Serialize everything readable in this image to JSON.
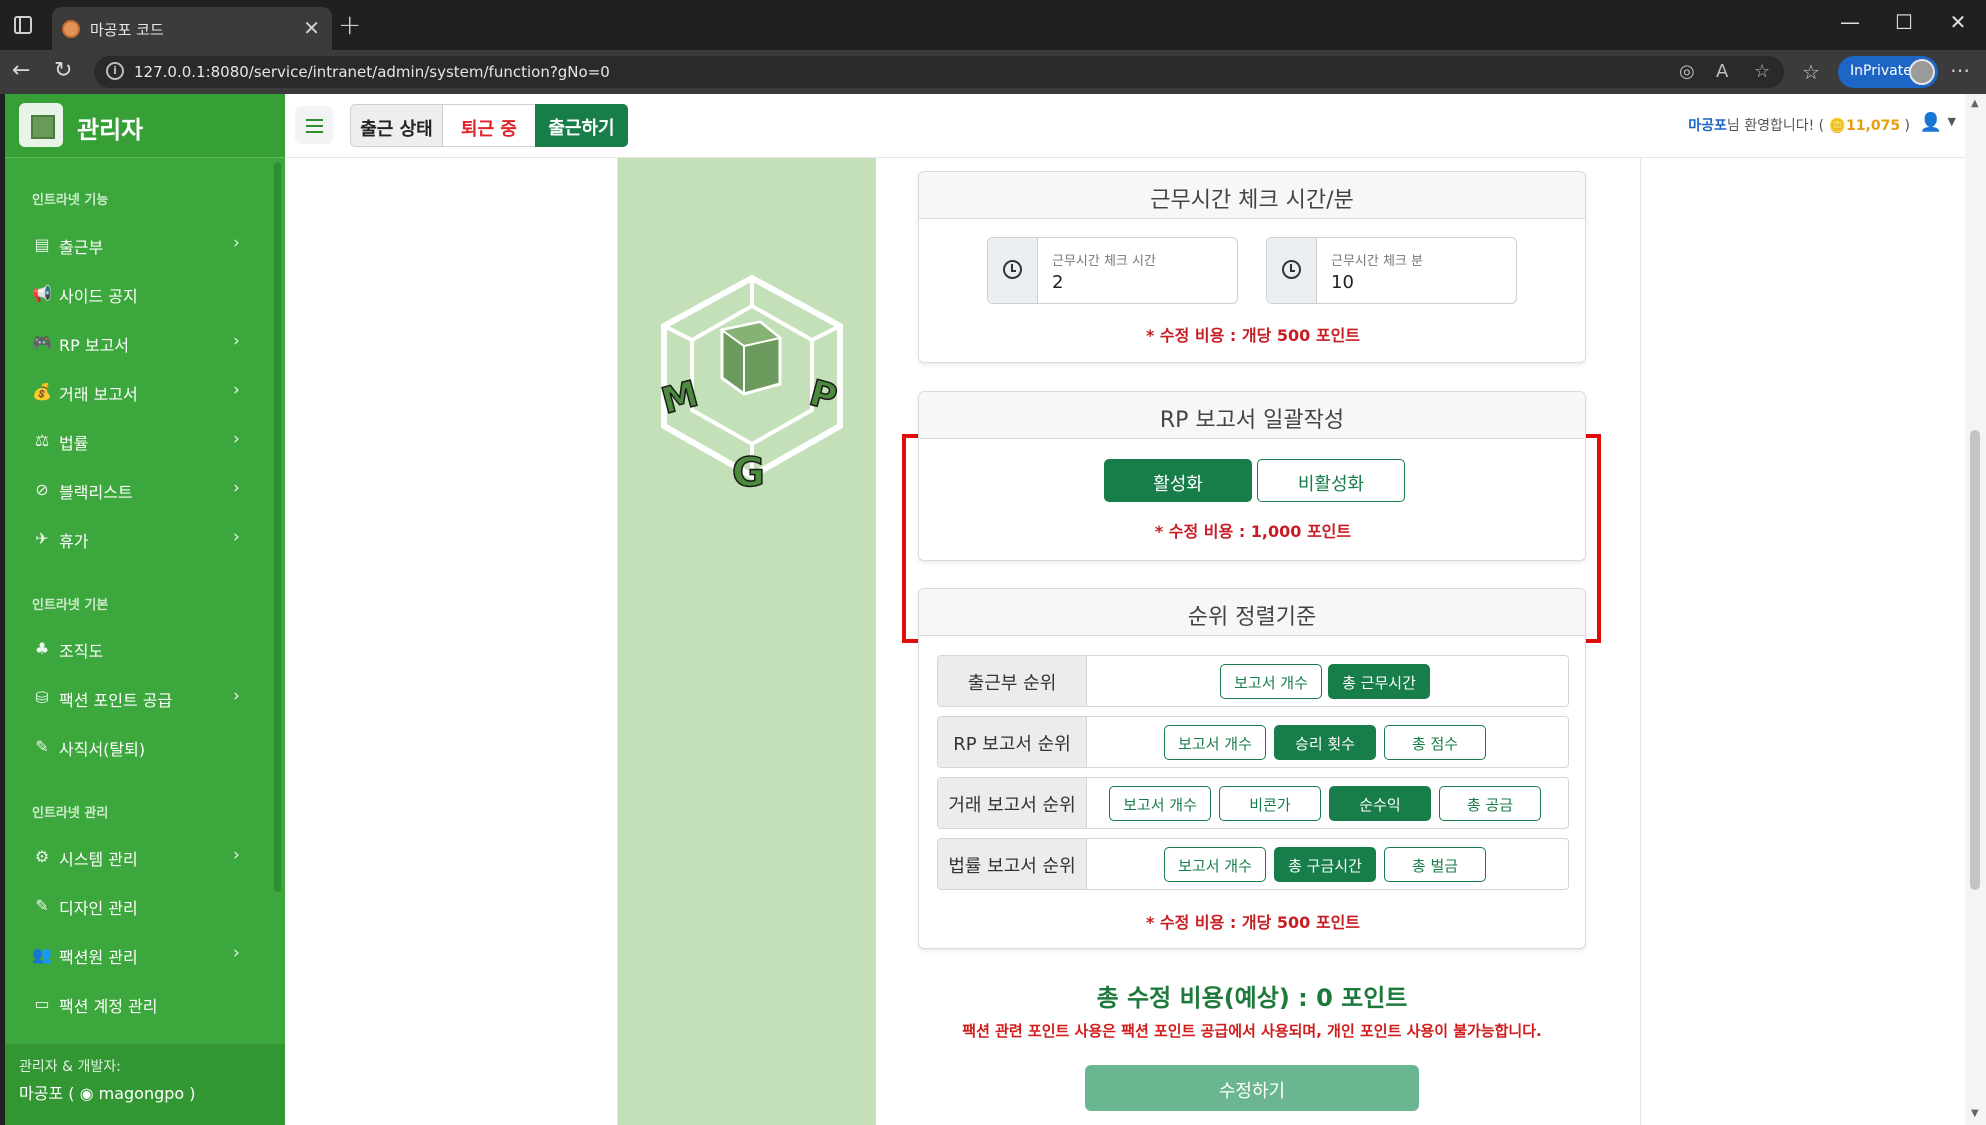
{
  "browser": {
    "tab_title": "마공포 코드",
    "url": "127.0.0.1:8080/service/intranet/admin/system/function?gNo=0",
    "inprivate_label": "InPrivate"
  },
  "sidebar": {
    "brand": "관리자",
    "sections": [
      {
        "title": "인트라넷 기능"
      },
      {
        "title": "인트라넷 기본"
      },
      {
        "title": "인트라넷 관리"
      }
    ],
    "items": [
      {
        "label": "출근부",
        "icon": "book-icon",
        "glyph": "▤"
      },
      {
        "label": "사이드 공지",
        "icon": "megaphone-icon",
        "glyph": "📢"
      },
      {
        "label": "RP 보고서",
        "icon": "gamepad-icon",
        "glyph": "🎮"
      },
      {
        "label": "거래 보고서",
        "icon": "money-bag-icon",
        "glyph": "💰"
      },
      {
        "label": "법률",
        "icon": "scale-icon",
        "glyph": "⚖"
      },
      {
        "label": "블랙리스트",
        "icon": "ban-icon",
        "glyph": "⊘"
      },
      {
        "label": "휴가",
        "icon": "plane-icon",
        "glyph": "✈"
      },
      {
        "label": "조직도",
        "icon": "org-chart-icon",
        "glyph": "♣"
      },
      {
        "label": "팩션 포인트 공급",
        "icon": "coins-icon",
        "glyph": "⛁"
      },
      {
        "label": "사직서(탈퇴)",
        "icon": "pen-icon",
        "glyph": "✎"
      },
      {
        "label": "시스템 관리",
        "icon": "gear-icon",
        "glyph": "⚙"
      },
      {
        "label": "디자인 관리",
        "icon": "brush-icon",
        "glyph": "✎"
      },
      {
        "label": "팩션원 관리",
        "icon": "users-icon",
        "glyph": "👥"
      },
      {
        "label": "팩션 계정 관리",
        "icon": "id-card-icon",
        "glyph": "▭"
      }
    ],
    "footer_line1": "관리자 & 개발자:",
    "footer_line2": "마공포 ( ◉ magongpo )"
  },
  "topbar": {
    "status_label": "출근 상태",
    "status_value": "퇴근 중",
    "checkin_button": "출근하기",
    "user_name": "마공포",
    "greeting_suffix": "님 환영합니다! (",
    "points": "🪙11,075",
    "greeting_close": " )"
  },
  "work_time_card": {
    "title": "근무시간 체크 시간/분",
    "hour_label": "근무시간 체크 시간",
    "hour_value": "2",
    "minute_label": "근무시간 체크 분",
    "minute_value": "10",
    "cost": "* 수정 비용 : 개당 500 포인트"
  },
  "rp_bulk_card": {
    "title": "RP 보고서 일괄작성",
    "enable": "활성화",
    "disable": "비활성화",
    "cost": "* 수정 비용 : 1,000 포인트"
  },
  "rank_card": {
    "title": "순위 정렬기준",
    "rows": [
      {
        "label": "출근부 순위",
        "options": [
          "보고서 개수",
          "총 근무시간"
        ]
      },
      {
        "label": "RP 보고서 순위",
        "options": [
          "보고서 개수",
          "승리 횟수",
          "총 점수"
        ]
      },
      {
        "label": "거래 보고서 순위",
        "options": [
          "보고서 개수",
          "비콘가",
          "순수익",
          "총 공금"
        ]
      },
      {
        "label": "법률 보고서 순위",
        "options": [
          "보고서 개수",
          "총 구금시간",
          "총 벌금"
        ]
      }
    ],
    "cost": "* 수정 비용 : 개당 500 포인트"
  },
  "total": {
    "title": "총 수정 비용(예상) : 0 포인트",
    "note": "팩션 관련 포인트 사용은 팩션 포인트 공급에서 사용되며, 개인 포인트 사용이 불가능합니다.",
    "submit": "수정하기"
  },
  "colors": {
    "sidebar": "#3ca73c",
    "primary": "#177e4a",
    "danger": "#c81d25",
    "highlight": "#e00d0d"
  }
}
